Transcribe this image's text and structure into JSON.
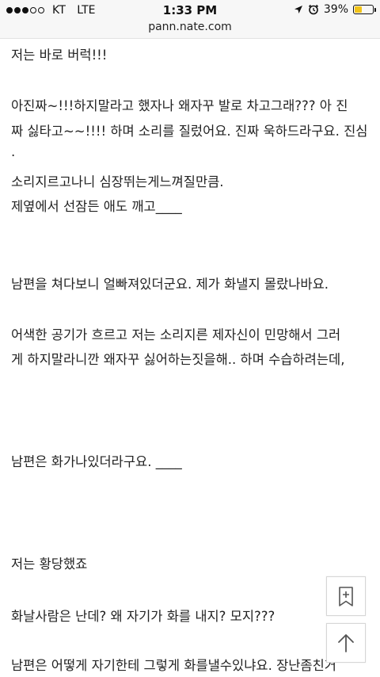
{
  "status_bar": {
    "carrier": "KT",
    "network": "LTE",
    "time": "1:33 PM",
    "battery": "39%",
    "battery_level": 0.39,
    "signal_bars": 3,
    "signal_total": 5,
    "icons": [
      "location-arrow-icon",
      "alarm-clock-icon"
    ]
  },
  "address_bar": {
    "url": "pann.nate.com"
  },
  "article": {
    "lines": [
      "저는 바로 버럭!!!",
      "아진짜~!!!하지말라고 했자나 왜자꾸 발로 차고그래??? 아 진",
      "짜 싫타고~~!!!! 하며 소리를 질렀어요. 진짜 욱하드라구요. 진심",
      ".",
      "소리지르고나니 심장뛰는게느껴질만큼.",
      "제옆에서 선잠든 애도 깨고____",
      "남편을 쳐다보니 얼빠져있더군요. 제가 화낼지 몰랐나바요.",
      "어색한 공기가 흐르고 저는 소리지른 제자신이 민망해서 그러",
      "게 하지말라니깐 왜자꾸 싫어하는짓을해.. 하며 수습하려는데,",
      "남편은 화가나있더라구요. ____",
      "저는 황당했죠",
      "화날사람은 난데? 왜 자기가 화를 내지? 모지???",
      "남편은 어떻게 자기한테 그렇게 화를낼수있냐요. 장난좀친거"
    ]
  },
  "floating_buttons": {
    "bookmark": "bookmark-add-icon",
    "scroll_top": "arrow-up-icon"
  }
}
